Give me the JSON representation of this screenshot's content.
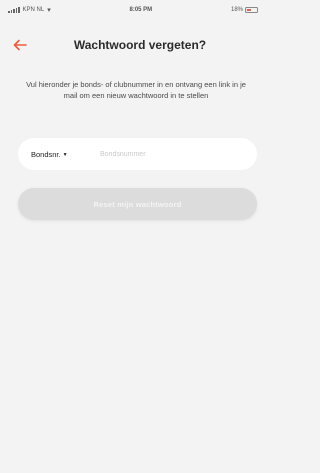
{
  "status_bar": {
    "carrier": "KPN NL",
    "time": "8:05 PM",
    "battery": "18%"
  },
  "header": {
    "title": "Wachtwoord vergeten?",
    "back_icon": "arrow-left-icon"
  },
  "description": "Vul hieronder je bonds- of clubnummer in en ontvang een link in je mail om een nieuw wachtwoord in te stellen",
  "form": {
    "select_value": "Bondsnr.",
    "caret": "▼",
    "input_placeholder": "Bondsnummer",
    "input_value": "",
    "submit_label": "Reset mijn wachtwoord"
  },
  "colors": {
    "accent": "#ee5a3c",
    "background": "#f3f3f3",
    "button_disabled": "#dcdcdc"
  }
}
